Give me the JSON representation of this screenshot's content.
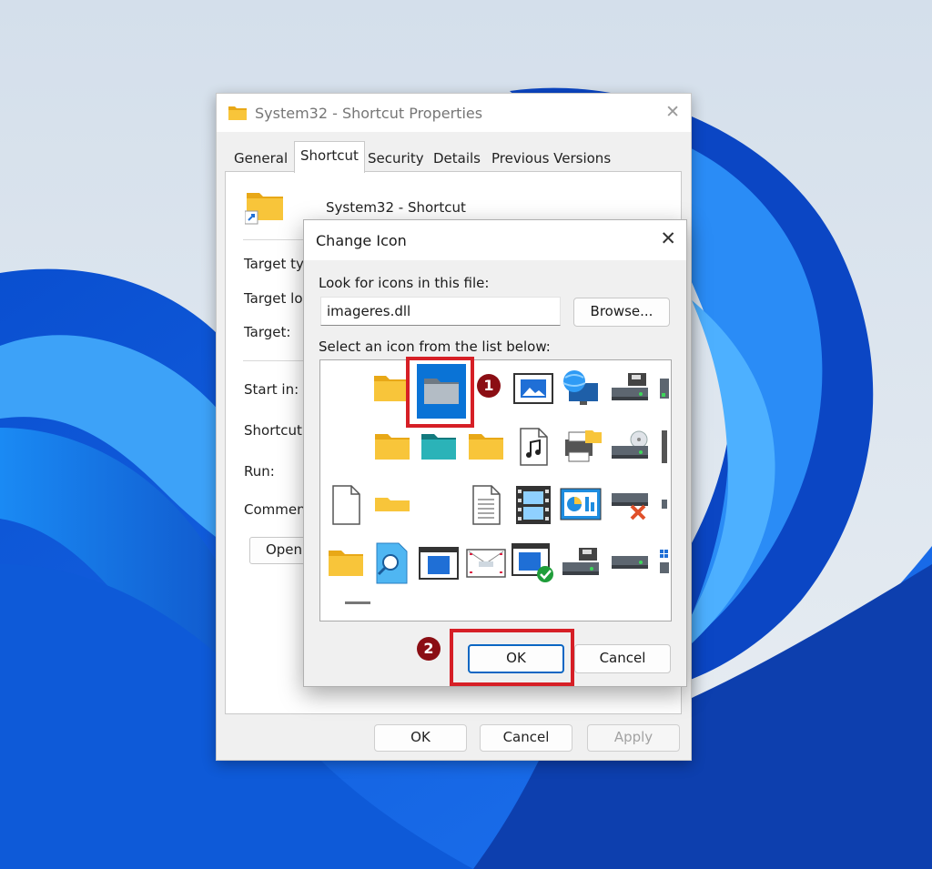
{
  "window": {
    "title": "System32 - Shortcut Properties",
    "close_glyph": "✕",
    "tabs": [
      {
        "label": "General",
        "active": false
      },
      {
        "label": "Shortcut",
        "active": true
      },
      {
        "label": "Security",
        "active": false
      },
      {
        "label": "Details",
        "active": false
      },
      {
        "label": "Previous Versions",
        "active": false
      }
    ],
    "shortcut_name": "System32 - Shortcut",
    "fields": {
      "target_type": "Target typ",
      "target_location": "Target loc",
      "target": "Target:",
      "start_in": "Start in:",
      "shortcut_key": "Shortcut k",
      "run": "Run:",
      "comment": "Comment:"
    },
    "open_button": "Open",
    "buttons": {
      "ok": "OK",
      "cancel": "Cancel",
      "apply": "Apply"
    }
  },
  "dialog": {
    "title": "Change Icon",
    "close_glyph": "✕",
    "look_label": "Look for icons in this file:",
    "file_value": "imageres.dll",
    "browse_label": "Browse...",
    "select_label": "Select an icon from the list below:",
    "icons": [
      [
        "empty",
        "folder-icon",
        "folder-gray-icon",
        "picture-frame-icon",
        "globe-monitor-icon",
        "drive-floppy-icon",
        "device-partial-icon"
      ],
      [
        "empty",
        "folder-icon",
        "folder-teal-icon",
        "folder-icon",
        "music-file-icon",
        "printer-folder-icon",
        "drive-cd-icon"
      ],
      [
        "blank-file-icon",
        "folder-flat-icon",
        "empty",
        "text-document-icon",
        "film-icon",
        "chart-icon",
        "drive-error-icon"
      ],
      [
        "folder-icon",
        "search-file-icon",
        "window-icon",
        "envelope-icon",
        "window-check-icon",
        "drive-floppy-icon",
        "drive-windows-icon"
      ],
      [
        "dash-icon"
      ]
    ],
    "selected_icon": "folder-gray-icon",
    "ok_label": "OK",
    "cancel_label": "Cancel"
  },
  "annotations": {
    "step1": "1",
    "step2": "2"
  },
  "colors": {
    "accent": "#0a73d6",
    "highlight": "#d61f26",
    "marker": "#8b0e14",
    "folder": "#f8c53a"
  }
}
